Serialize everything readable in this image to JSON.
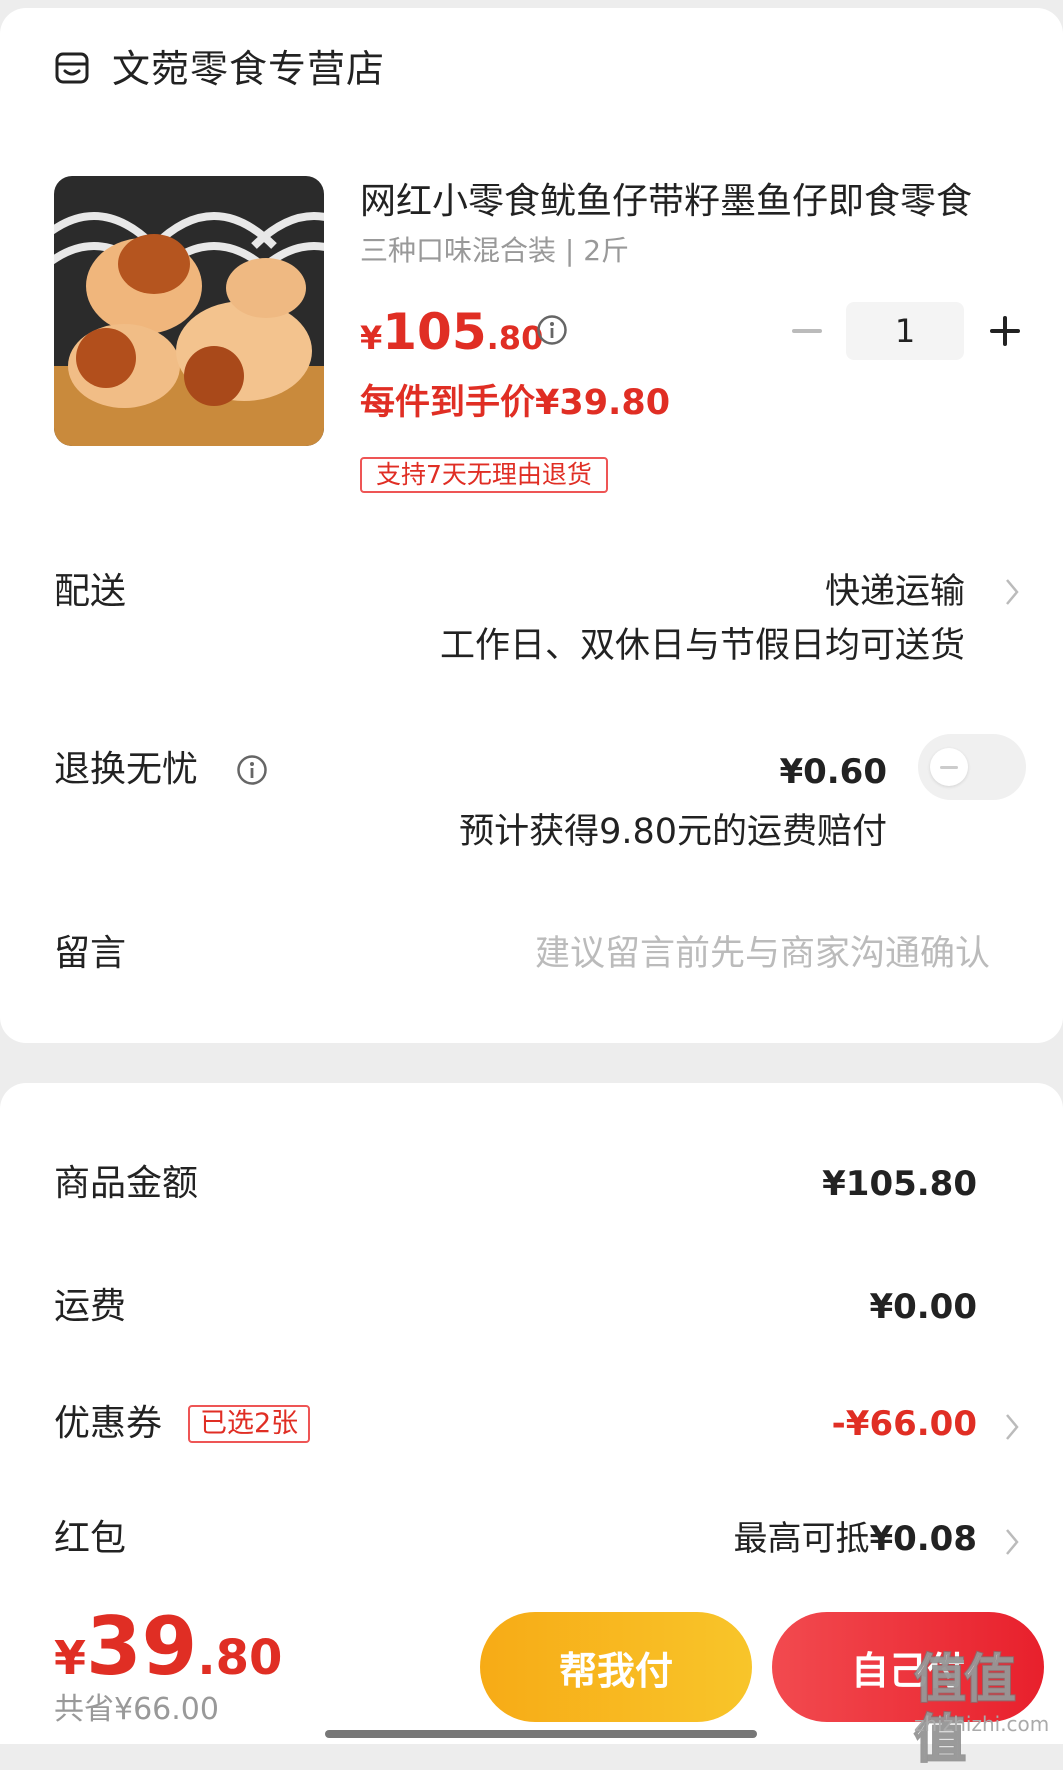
{
  "store": {
    "name": "文菀零食专营店",
    "icon": "store-icon"
  },
  "product": {
    "title": "网红小零食鱿鱼仔带籽墨鱼仔即食零食",
    "spec": "三种口味混合装 | 2斤",
    "price": {
      "currency": "¥",
      "integer": "105",
      "decimal": ".80"
    },
    "per_piece_price": "每件到手价¥39.80",
    "return_tag": "支持7天无理由退货",
    "quantity": "1"
  },
  "delivery": {
    "label": "配送",
    "value": "快递运输",
    "sub": "工作日、双休日与节假日均可送货"
  },
  "return_insurance": {
    "label": "退换无忧",
    "price": "¥0.60",
    "sub": "预计获得9.80元的运费赔付",
    "toggle_on": false
  },
  "message": {
    "label": "留言",
    "placeholder": "建议留言前先与商家沟通确认"
  },
  "summary": {
    "goods_label": "商品金额",
    "goods_value": "¥105.80",
    "shipping_label": "运费",
    "shipping_value": "¥0.00",
    "coupon_label": "优惠券",
    "coupon_badge": "已选2张",
    "coupon_value": "-¥66.00",
    "redpacket_label": "红包",
    "redpacket_prefix": "最高可抵",
    "redpacket_value": "¥0.08"
  },
  "footer": {
    "total": {
      "currency": "¥",
      "integer": "39",
      "decimal": ".80"
    },
    "saved": "共省¥66.00",
    "help_pay_label": "帮我付",
    "self_pay_label": "自己付"
  },
  "watermark": {
    "brand": "值值值",
    "url": "zhizhizhi.com"
  },
  "colors": {
    "accent_red": "#e02e24",
    "help_btn": "#f8b91f",
    "self_btn": "#ec2e33",
    "background": "#ededed"
  }
}
